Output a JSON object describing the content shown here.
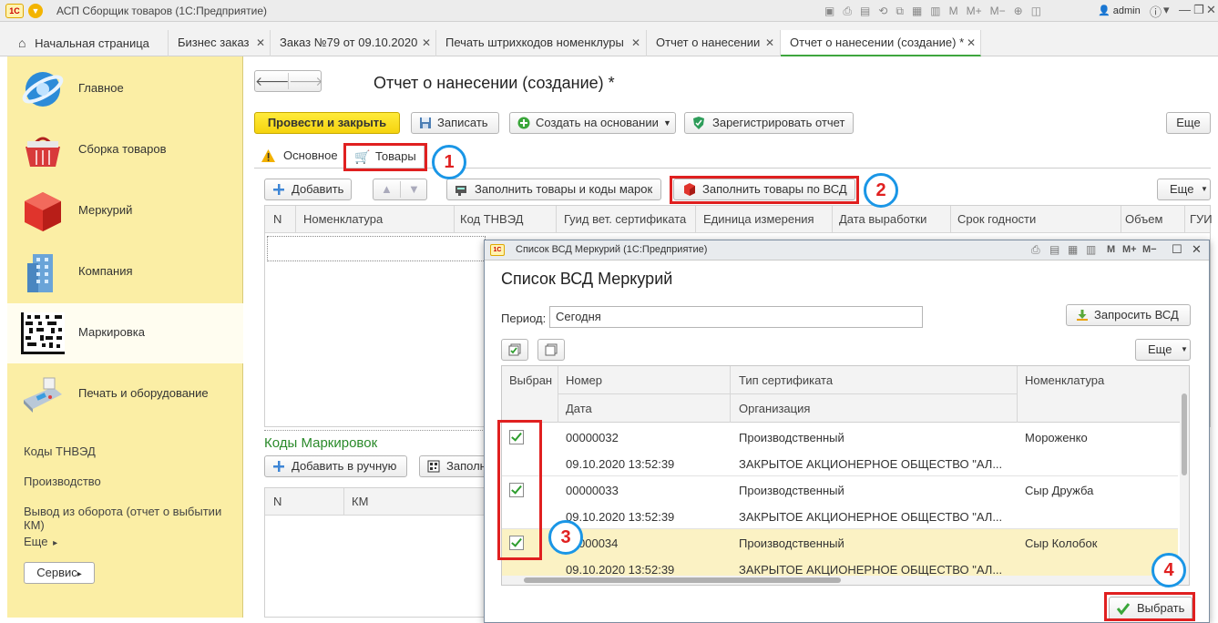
{
  "app": {
    "logo": "1С",
    "title": "АСП Сборщик товаров  (1С:Предприятие)",
    "user": "admin"
  },
  "open_tabs": [
    {
      "label": "Начальная страница"
    },
    {
      "label": "Бизнес заказ"
    },
    {
      "label": "Заказ №79 от 09.10.2020"
    },
    {
      "label": "Печать штрихкодов номенклуры"
    },
    {
      "label": "Отчет о нанесении"
    },
    {
      "label": "Отчет о нанесении (создание) *"
    }
  ],
  "sidebar": {
    "sections": [
      {
        "label": "Главное",
        "icon": "globe-icon"
      },
      {
        "label": "Сборка товаров",
        "icon": "basket-icon"
      },
      {
        "label": "Меркурий",
        "icon": "red-cube-icon"
      },
      {
        "label": "Компания",
        "icon": "building-icon"
      },
      {
        "label": "Маркировка",
        "icon": "datamatrix-icon"
      },
      {
        "label": "Печать и оборудование",
        "icon": "pos-terminal-icon"
      }
    ],
    "links": [
      "Коды ТНВЭД",
      "Производство",
      "Вывод из оборота (отчет о выбытии КМ)",
      "Еще"
    ],
    "more_arrow": "▸",
    "service_button": "Сервис"
  },
  "form": {
    "title": "Отчет о нанесении (создание) *",
    "nav_back": "🡐",
    "nav_forward": "🡒",
    "toolbar": {
      "post_close": "Провести и закрыть",
      "save": "Записать",
      "create_based": "Создать на основании",
      "register": "Зарегистрировать отчет",
      "more": "Еще"
    },
    "tabs": {
      "main": "Основное",
      "goods": "Товары"
    },
    "goods_toolbar": {
      "add": "Добавить",
      "fill_goods_codes": "Заполнить товары и коды марок",
      "fill_by_vsd": "Заполнить товары по ВСД",
      "more": "Еще"
    },
    "goods_columns": [
      "N",
      "Номенклатура",
      "Код ТНВЭД",
      "Гуид вет. сертификата",
      "Единица измерения",
      "Дата выработки",
      "Срок годности",
      "Объем",
      "ГУИ"
    ],
    "codes_section": {
      "title": "Коды Маркировок",
      "add_manual": "Добавить в ручную",
      "fill": "Заполн",
      "columns": [
        "N",
        "КМ"
      ]
    }
  },
  "modal": {
    "window_title": "Список ВСД Меркурий  (1С:Предприятие)",
    "title": "Список ВСД Меркурий",
    "period_label": "Период:",
    "period_value": "Сегодня",
    "period_btn": "...",
    "request_btn": "Запросить ВСД",
    "more": "Еще",
    "columns": {
      "selected": "Выбран",
      "number": "Номер",
      "date": "Дата",
      "cert_type": "Тип сертификата",
      "organization": "Организация",
      "nomenclature": "Номенклатура"
    },
    "rows": [
      {
        "number": "00000032",
        "date": "09.10.2020 13:52:39",
        "cert_type": "Производственный",
        "organization": "ЗАКРЫТОЕ АКЦИОНЕРНОЕ ОБЩЕСТВО \"АЛ...",
        "nomenclature": "Мороженко",
        "selected": true
      },
      {
        "number": "00000033",
        "date": "09.10.2020 13:52:39",
        "cert_type": "Производственный",
        "organization": "ЗАКРЫТОЕ АКЦИОНЕРНОЕ ОБЩЕСТВО \"АЛ...",
        "nomenclature": "Сыр Дружба",
        "selected": true
      },
      {
        "number": "000034",
        "date": "09.10.2020 13:52:39",
        "cert_type": "Производственный",
        "organization": "ЗАКРЫТОЕ АКЦИОНЕРНОЕ ОБЩЕСТВО \"АЛ...",
        "nomenclature": "Сыр Колобок",
        "selected": true
      }
    ],
    "select_btn": "Выбрать"
  },
  "annotations": [
    "1",
    "2",
    "3",
    "4"
  ],
  "colors": {
    "accent_yellow": "#ffeb3b",
    "sidebar": "#fbeea5",
    "annotation_red": "#e02020",
    "annotation_blue": "#1a96e6",
    "check_green": "#2e9d2e"
  }
}
